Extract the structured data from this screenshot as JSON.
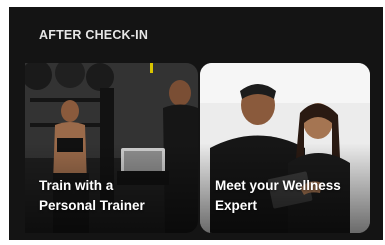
{
  "section": {
    "title": "AFTER CHECK-IN"
  },
  "cards": [
    {
      "title_line1": "Train with a",
      "title_line2": "Personal Trainer"
    },
    {
      "title_line1": "Meet your Wellness",
      "title_line2": "Expert"
    }
  ],
  "colors": {
    "background": "#141414",
    "heading_text": "#e6e6e6",
    "card_text": "#ffffff"
  }
}
